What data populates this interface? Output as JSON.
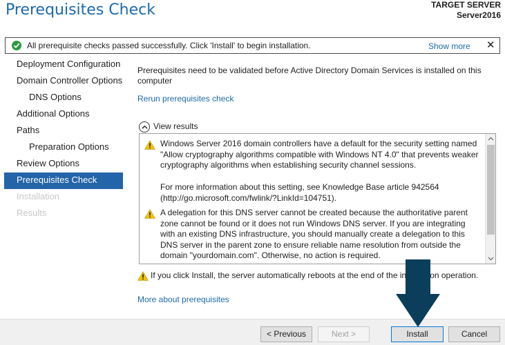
{
  "header": {
    "title": "Prerequisites Check",
    "target_label": "TARGET SERVER",
    "target_value": "Server2016"
  },
  "banner": {
    "message": "All prerequisite checks passed successfully.  Click 'Install' to begin installation.",
    "show_more": "Show more",
    "close": "✕",
    "status_color": "#2e9a3f"
  },
  "sidebar": {
    "items": [
      {
        "label": "Deployment Configuration",
        "state": "normal"
      },
      {
        "label": "Domain Controller Options",
        "state": "normal"
      },
      {
        "label": "DNS Options",
        "state": "normal"
      },
      {
        "label": "Additional Options",
        "state": "normal"
      },
      {
        "label": "Paths",
        "state": "normal"
      },
      {
        "label": "Preparation Options",
        "state": "normal"
      },
      {
        "label": "Review Options",
        "state": "normal"
      },
      {
        "label": "Prerequisites Check",
        "state": "active"
      },
      {
        "label": "Installation",
        "state": "disabled"
      },
      {
        "label": "Results",
        "state": "disabled"
      }
    ],
    "active_color": "#2464a8"
  },
  "main": {
    "intro": "Prerequisites need to be validated before Active Directory Domain Services is installed on this computer",
    "rerun_link": "Rerun prerequisites check",
    "view_results": "View results",
    "results": [
      {
        "icon": "warning-icon",
        "text": "Windows Server 2016 domain controllers have a default for the security setting named \"Allow cryptography algorithms compatible with Windows NT 4.0\" that prevents weaker cryptography algorithms when establishing security channel sessions.",
        "more": "For more information about this setting, see Knowledge Base article 942564 (http://go.microsoft.com/fwlink/?LinkId=104751)."
      },
      {
        "icon": "warning-icon",
        "text": "A delegation for this DNS server cannot be created because the authoritative parent zone cannot be found or it does not run Windows DNS server. If you are integrating with an existing DNS infrastructure, you should manually create a delegation to this DNS server in the parent zone to ensure reliable name resolution from outside the domain \"yourdomain.com\". Otherwise, no action is required."
      }
    ],
    "reboot_note": "If you click Install, the server automatically reboots at the end of the installation operation.",
    "more_link": "More about prerequisites"
  },
  "footer": {
    "previous": "< Previous",
    "next": "Next >",
    "install": "Install",
    "cancel": "Cancel"
  },
  "colors": {
    "link": "#1d6aa9",
    "title": "#1d6aa9",
    "warning": "#f2c200",
    "arrow": "#0a3e5a"
  }
}
